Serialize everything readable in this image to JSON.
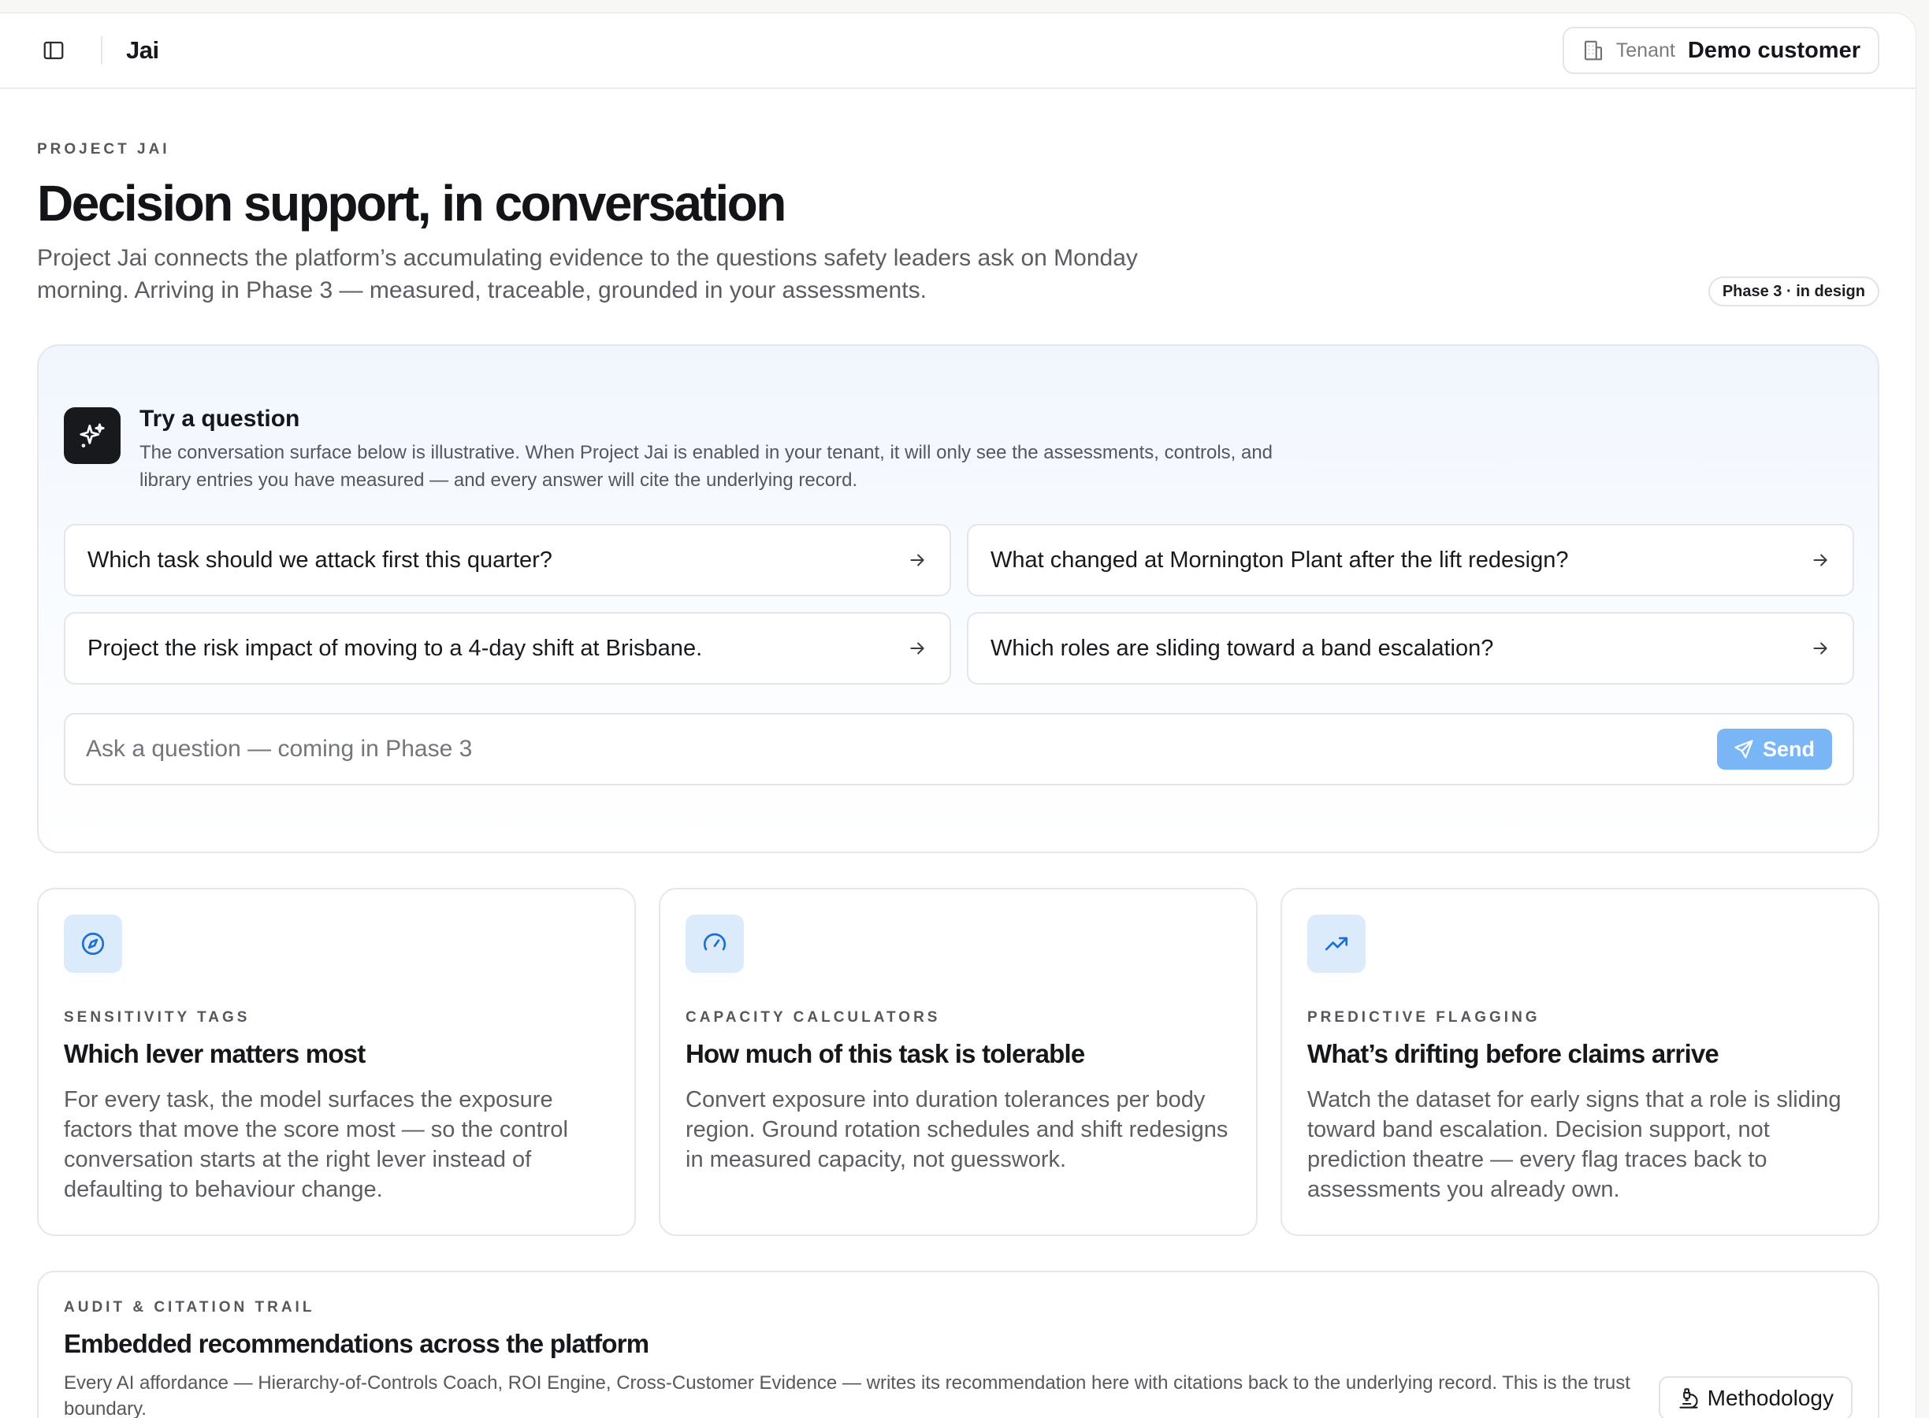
{
  "header": {
    "app_title": "Jai",
    "tenant_label": "Tenant",
    "tenant_value": "Demo customer"
  },
  "hero": {
    "eyebrow": "PROJECT JAI",
    "title": "Decision support, in conversation",
    "description": "Project Jai connects the platform’s accumulating evidence to the questions safety leaders ask on Monday morning. Arriving in Phase 3 — measured, traceable, grounded in your assessments.",
    "phase_badge": "Phase 3 · in design"
  },
  "try_panel": {
    "title": "Try a question",
    "description": "The conversation surface below is illustrative. When Project Jai is enabled in your tenant, it will only see the assessments, controls, and library entries you have measured — and every answer will cite the underlying record.",
    "questions": [
      "Which task should we attack first this quarter?",
      "What changed at Mornington Plant after the lift redesign?",
      "Project the risk impact of moving to a 4-day shift at Brisbane.",
      "Which roles are sliding toward a band escalation?"
    ],
    "ask_placeholder": "Ask a question — coming in Phase 3",
    "send_label": "Send"
  },
  "features": [
    {
      "eyebrow": "SENSITIVITY TAGS",
      "title": "Which lever matters most",
      "description": "For every task, the model surfaces the exposure factors that move the score most — so the control conversation starts at the right lever instead of defaulting to behaviour change.",
      "icon": "compass-icon"
    },
    {
      "eyebrow": "CAPACITY CALCULATORS",
      "title": "How much of this task is tolerable",
      "description": "Convert exposure into duration tolerances per body region. Ground rotation schedules and shift redesigns in measured capacity, not guesswork.",
      "icon": "gauge-icon"
    },
    {
      "eyebrow": "PREDICTIVE FLAGGING",
      "title": "What’s drifting before claims arrive",
      "description": "Watch the dataset for early signs that a role is sliding toward band escalation. Decision support, not prediction theatre — every flag traces back to assessments you already own.",
      "icon": "trending-up-icon"
    }
  ],
  "audit": {
    "eyebrow": "AUDIT & CITATION TRAIL",
    "title": "Embedded recommendations across the platform",
    "description": "Every AI affordance — Hierarchy-of-Controls Coach, ROI Engine, Cross-Customer Evidence — writes its recommendation here with citations back to the underlying record. This is the trust boundary.",
    "methodology_label": "Methodology"
  },
  "colors": {
    "accent": "#1d6fd1",
    "icon_bg": "#dcebfc",
    "send_button": "#7ab6f5"
  }
}
